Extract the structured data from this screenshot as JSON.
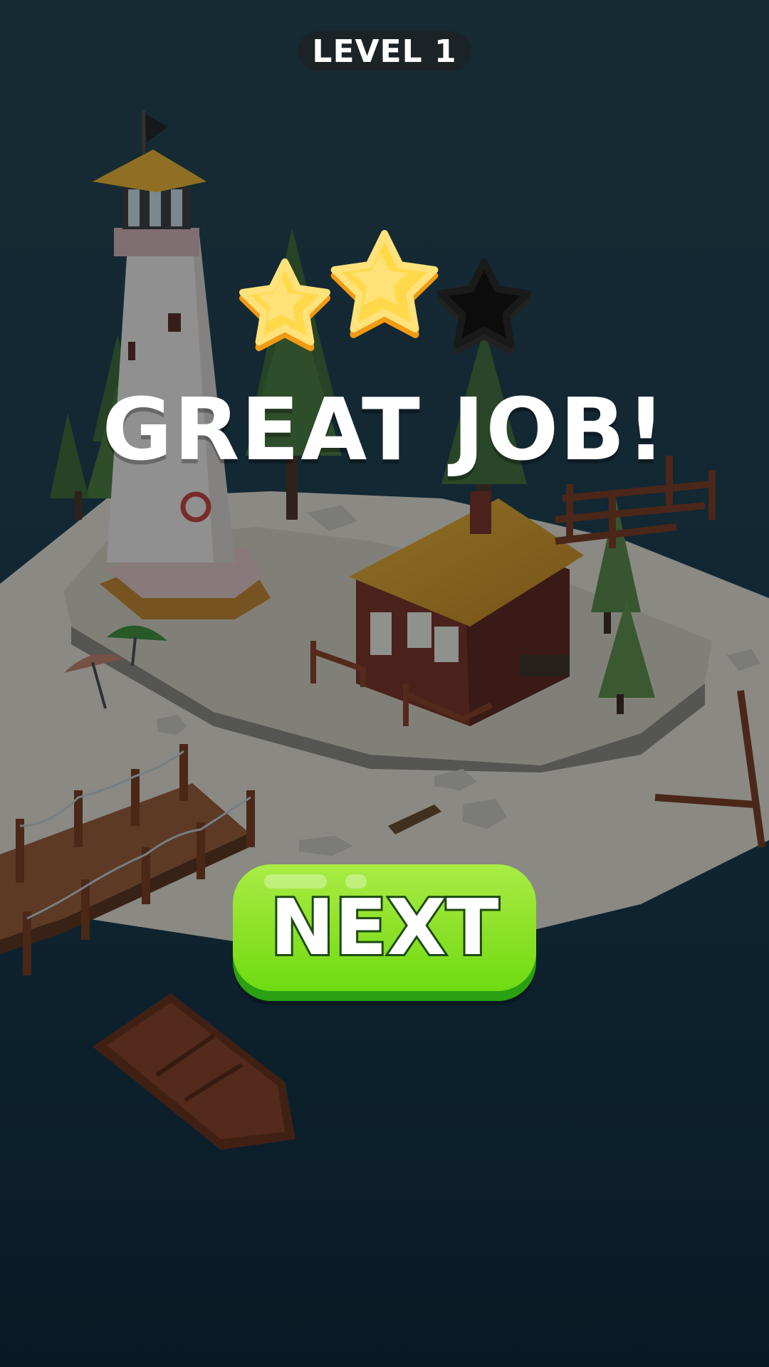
{
  "level_label": "LEVEL 1",
  "headline": "GREAT JOB!",
  "next_button_label": "NEXT",
  "rating": {
    "earned": 2,
    "total": 3
  },
  "colors": {
    "star_fill": "#ffd94a",
    "star_edge": "#f29a12",
    "star_empty": "#0c0c0c",
    "button_green": "#8ee22a",
    "button_shadow": "#2aa012",
    "water": "#12303f",
    "sand": "#e9e2d2"
  }
}
